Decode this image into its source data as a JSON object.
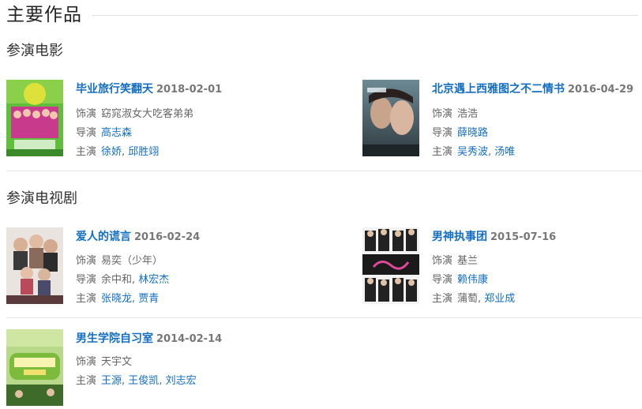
{
  "page_title": "主要作品",
  "sections": [
    {
      "title": "参演电影",
      "works": [
        {
          "title": "毕业旅行笑翻天",
          "date": "2018-02-01",
          "role_label": "饰演",
          "role": "窈窕淑女大吃客弟弟",
          "director_label": "导演",
          "directors": [
            "高志森"
          ],
          "cast_label": "主演",
          "cast": [
            "徐娇",
            "邱胜翊"
          ]
        },
        {
          "title": "北京遇上西雅图之不二情书",
          "date": "2016-04-29",
          "role_label": "饰演",
          "role": "浩浩",
          "director_label": "导演",
          "directors": [
            "薛晓路"
          ],
          "cast_label": "主演",
          "cast": [
            "吴秀波",
            "汤唯"
          ]
        }
      ]
    },
    {
      "title": "参演电视剧",
      "works": [
        {
          "title": "爱人的谎言",
          "date": "2016-02-24",
          "role_label": "饰演",
          "role": "易奕（少年）",
          "director_label": "导演",
          "directors": [
            "余中和",
            "林宏杰"
          ],
          "cast_label": "主演",
          "cast": [
            "张晓龙",
            "贾青"
          ]
        },
        {
          "title": "男神执事团",
          "date": "2015-07-16",
          "role_label": "饰演",
          "role": "基兰",
          "director_label": "导演",
          "directors": [
            "赖伟康"
          ],
          "cast_label": "主演",
          "cast": [
            "蒲萄",
            "郑业成"
          ]
        },
        {
          "title": "男生学院自习室",
          "date": "2014-02-14",
          "role_label": "饰演",
          "role": "天宇文",
          "cast_label": "主演",
          "cast": [
            "王源",
            "王俊凯",
            "刘志宏"
          ]
        }
      ]
    }
  ],
  "colors": {
    "link": "#136ec2",
    "date": "#777777",
    "label": "#666666",
    "divider": "#e6e6e6"
  }
}
